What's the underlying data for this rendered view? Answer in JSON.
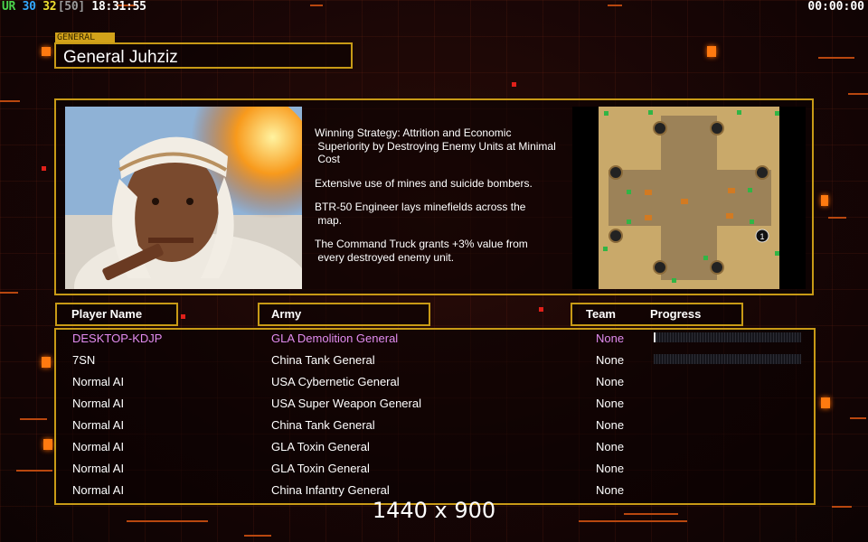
{
  "colors": {
    "gold_border": "#c89a16",
    "accent_orange": "#ff7a10",
    "local_player": "#e28cf0",
    "background": "#170606"
  },
  "status_bar": {
    "stats": [
      {
        "text": "UR",
        "color": "#4cd44c"
      },
      {
        "text": "30",
        "color": "#34a8ff"
      },
      {
        "text": "32",
        "color": "#f0e030"
      },
      {
        "text": "[50]",
        "color": "#9a9a9a"
      },
      {
        "text": "18:31:55",
        "color": "#ffffff"
      }
    ],
    "game_timer": "00:00:00"
  },
  "general": {
    "tab_label": "GENERAL",
    "name": "General Juhziz",
    "portrait_icon": "general-portrait-image",
    "description": [
      "Winning Strategy: Attrition and Economic\n Superiority by Destroying Enemy Units at Minimal\n Cost",
      "Extensive use of mines and suicide bombers.",
      "BTR-50 Engineer lays minefields across the\n map.",
      "The Command Truck grants +3% value from\n every destroyed enemy unit."
    ]
  },
  "map": {
    "icon": "desert-map-preview",
    "start_marker": "1"
  },
  "table": {
    "headers": {
      "player": "Player Name",
      "army": "Army",
      "team": "Team",
      "progress": "Progress"
    },
    "rows": [
      {
        "name": "DESKTOP-KDJP",
        "army": "GLA Demolition General",
        "team": "None",
        "local": true,
        "progress": 0
      },
      {
        "name": "7SN",
        "army": "China Tank General",
        "team": "None",
        "local": false,
        "progress": 0
      },
      {
        "name": "Normal AI",
        "army": "USA Cybernetic General",
        "team": "None",
        "local": false
      },
      {
        "name": "Normal AI",
        "army": "USA Super Weapon General",
        "team": "None",
        "local": false
      },
      {
        "name": "Normal AI",
        "army": "China Tank General",
        "team": "None",
        "local": false
      },
      {
        "name": "Normal AI",
        "army": "GLA Toxin General",
        "team": "None",
        "local": false
      },
      {
        "name": "Normal AI",
        "army": "GLA Toxin General",
        "team": "None",
        "local": false
      },
      {
        "name": "Normal AI",
        "army": "China Infantry General",
        "team": "None",
        "local": false
      }
    ]
  },
  "resolution_overlay": "1440 x 900"
}
